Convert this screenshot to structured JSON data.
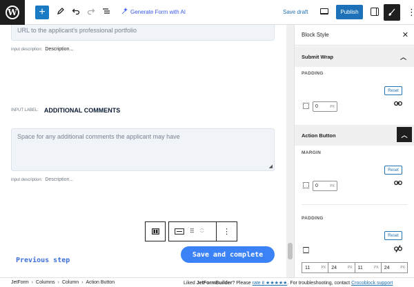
{
  "toolbar": {
    "add_label": "+",
    "generate_form_label": "Generate Form with AI",
    "save_draft_label": "Save draft",
    "publish_label": "Publish"
  },
  "canvas": {
    "portfolio_placeholder": "URL to the applicant's professional portfolio",
    "portfolio_desc_label": "input description:",
    "portfolio_desc_value": "Description...",
    "comments_input_label": "INPUT LABEL:",
    "comments_label_value": "ADDITIONAL COMMENTS",
    "comments_placeholder": "Space for any additional comments the applicant may have",
    "comments_desc_label": "input description:",
    "comments_desc_value": "Description...",
    "previous_step_label": "Previous step",
    "submit_label": "Save and complete"
  },
  "sidebar": {
    "title": "Block Style",
    "submit_wrap": {
      "title": "Submit Wrap",
      "padding_label": "PADDING",
      "reset_label": "Reset",
      "padding_value": "0",
      "unit": "PX"
    },
    "action_button": {
      "title": "Action Button",
      "margin_label": "MARGIN",
      "reset_label": "Reset",
      "margin_value": "0",
      "padding_label": "PADDING",
      "padding_reset_label": "Reset",
      "padding_values": [
        "11",
        "24",
        "11",
        "24"
      ],
      "unit": "PX"
    }
  },
  "footer": {
    "breadcrumbs": [
      "JetForm",
      "Columns",
      "Column",
      "Action Button"
    ],
    "message_prefix": "Liked ",
    "message_brand": "JetFormBuilder",
    "message_mid": "? Please ",
    "message_link": "rate it ★★★★★",
    "message_suffix": ". For troubleshooting, contact ",
    "message_link2": "Crocoblock support"
  }
}
